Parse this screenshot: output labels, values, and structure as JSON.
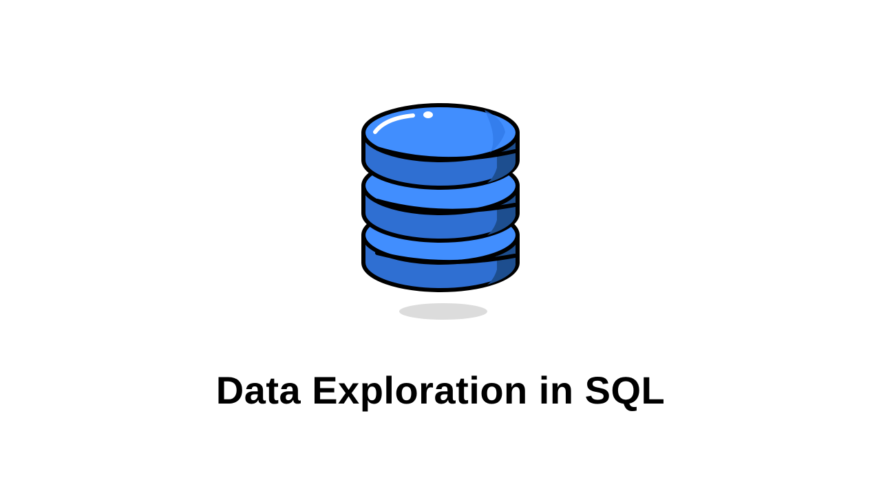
{
  "title": "Data Exploration in SQL",
  "icon": {
    "name": "database-icon",
    "colors": {
      "top": "#418efe",
      "side": "#2f6fd2",
      "side_shade": "#1d4e8f",
      "outline": "#000000",
      "highlight": "#ffffff",
      "shadow": "#dcdcdc"
    }
  }
}
